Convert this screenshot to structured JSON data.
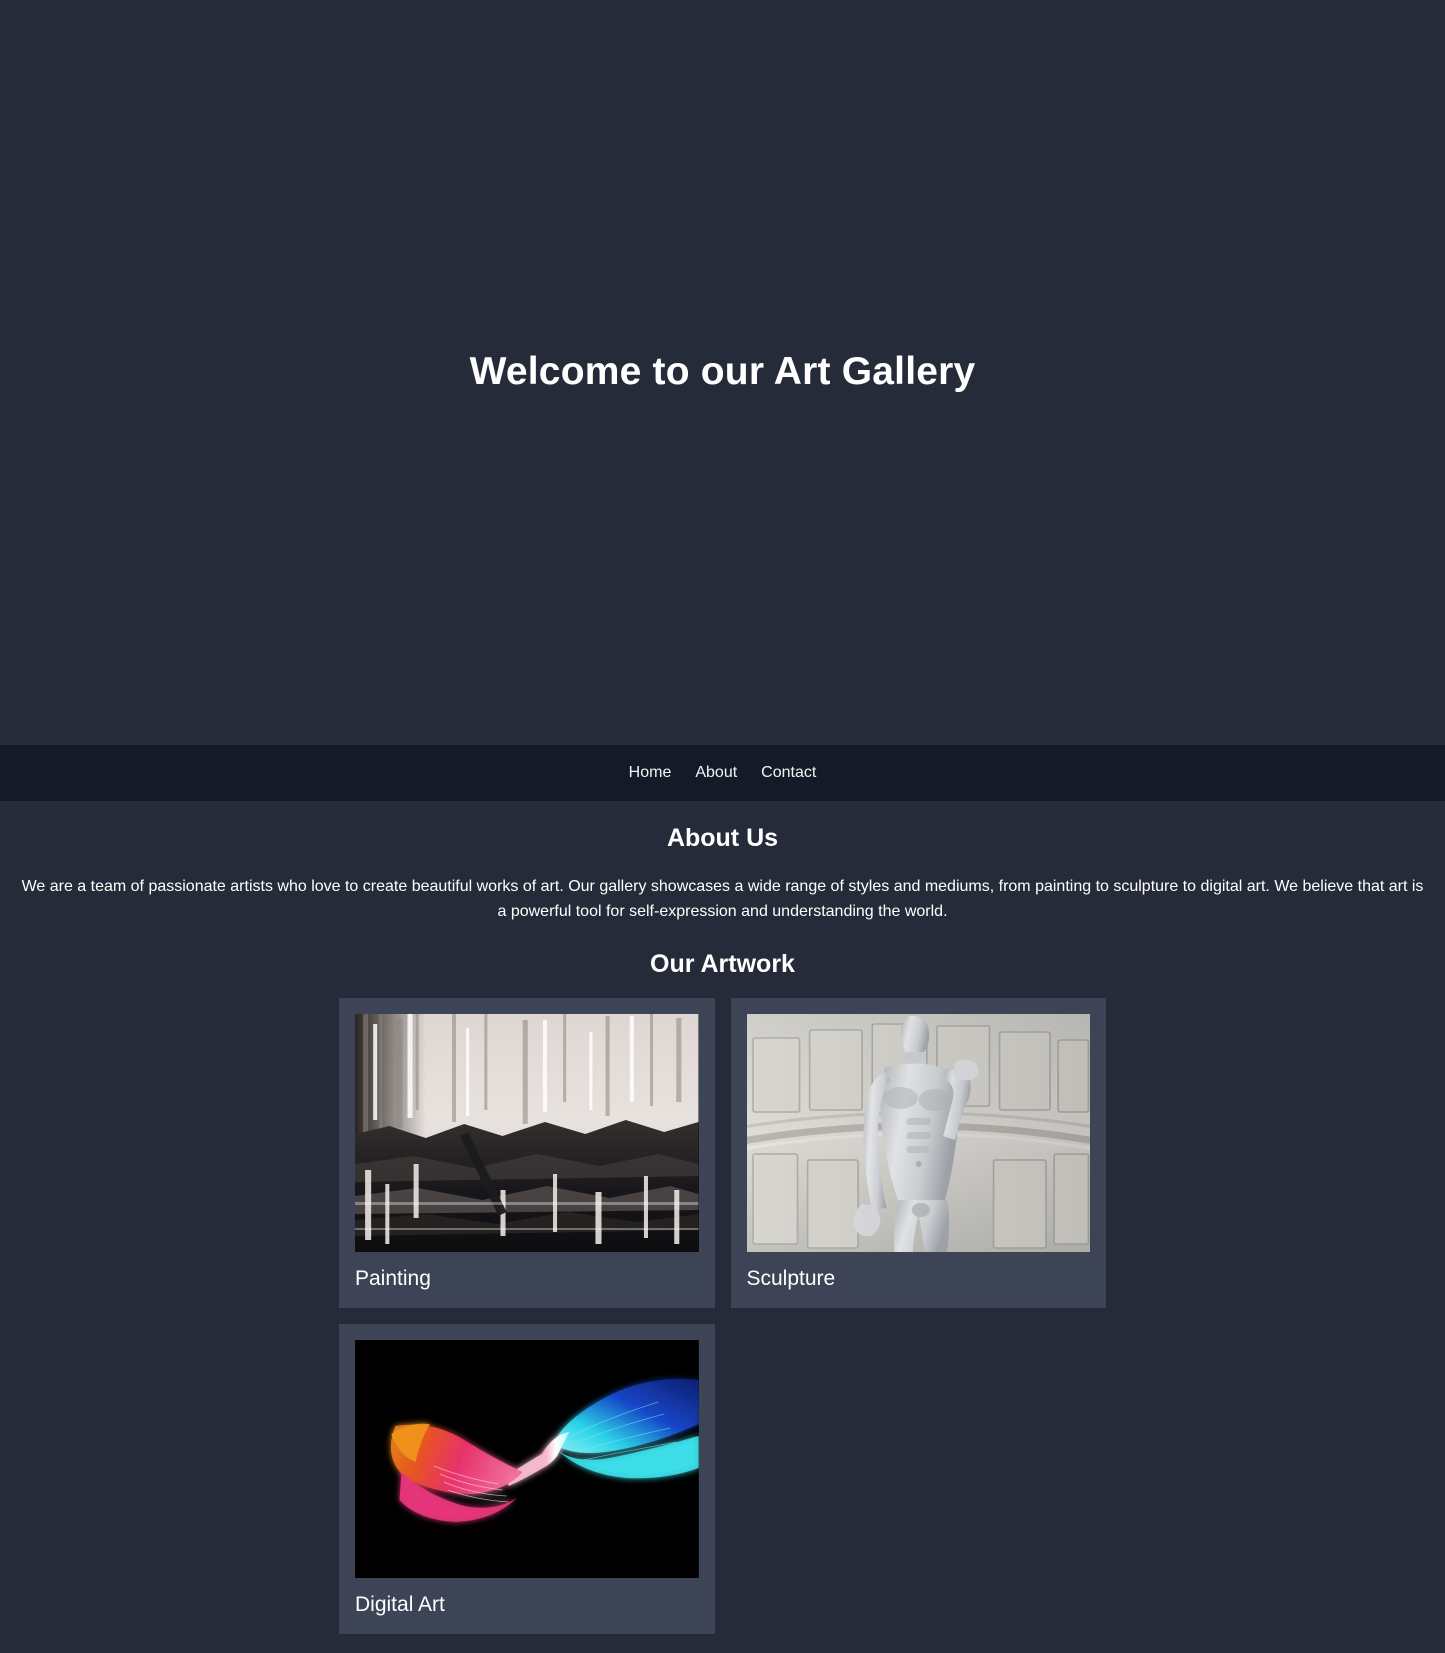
{
  "colors": {
    "page_background": "#252b38",
    "nav_background": "#151a28",
    "card_background": "#3d4456",
    "text": "#ffffff"
  },
  "hero": {
    "title": "Welcome to our Art Gallery"
  },
  "nav": {
    "items": [
      {
        "label": "Home"
      },
      {
        "label": "About"
      },
      {
        "label": "Contact"
      }
    ]
  },
  "about": {
    "heading": "About Us",
    "body": "We are a team of passionate artists who love to create beautiful works of art. Our gallery showcases a wide range of styles and mediums, from painting to sculpture to digital art. We believe that art is a powerful tool for self-expression and understanding the world."
  },
  "artwork": {
    "heading": "Our Artwork",
    "cards": [
      {
        "title": "Painting",
        "image_name": "abstract-black-white-painting-image"
      },
      {
        "title": "Sculpture",
        "image_name": "marble-statue-david-sculpture-image"
      },
      {
        "title": "Digital Art",
        "image_name": "colorful-flowing-ribbon-digital-art-image"
      }
    ]
  }
}
